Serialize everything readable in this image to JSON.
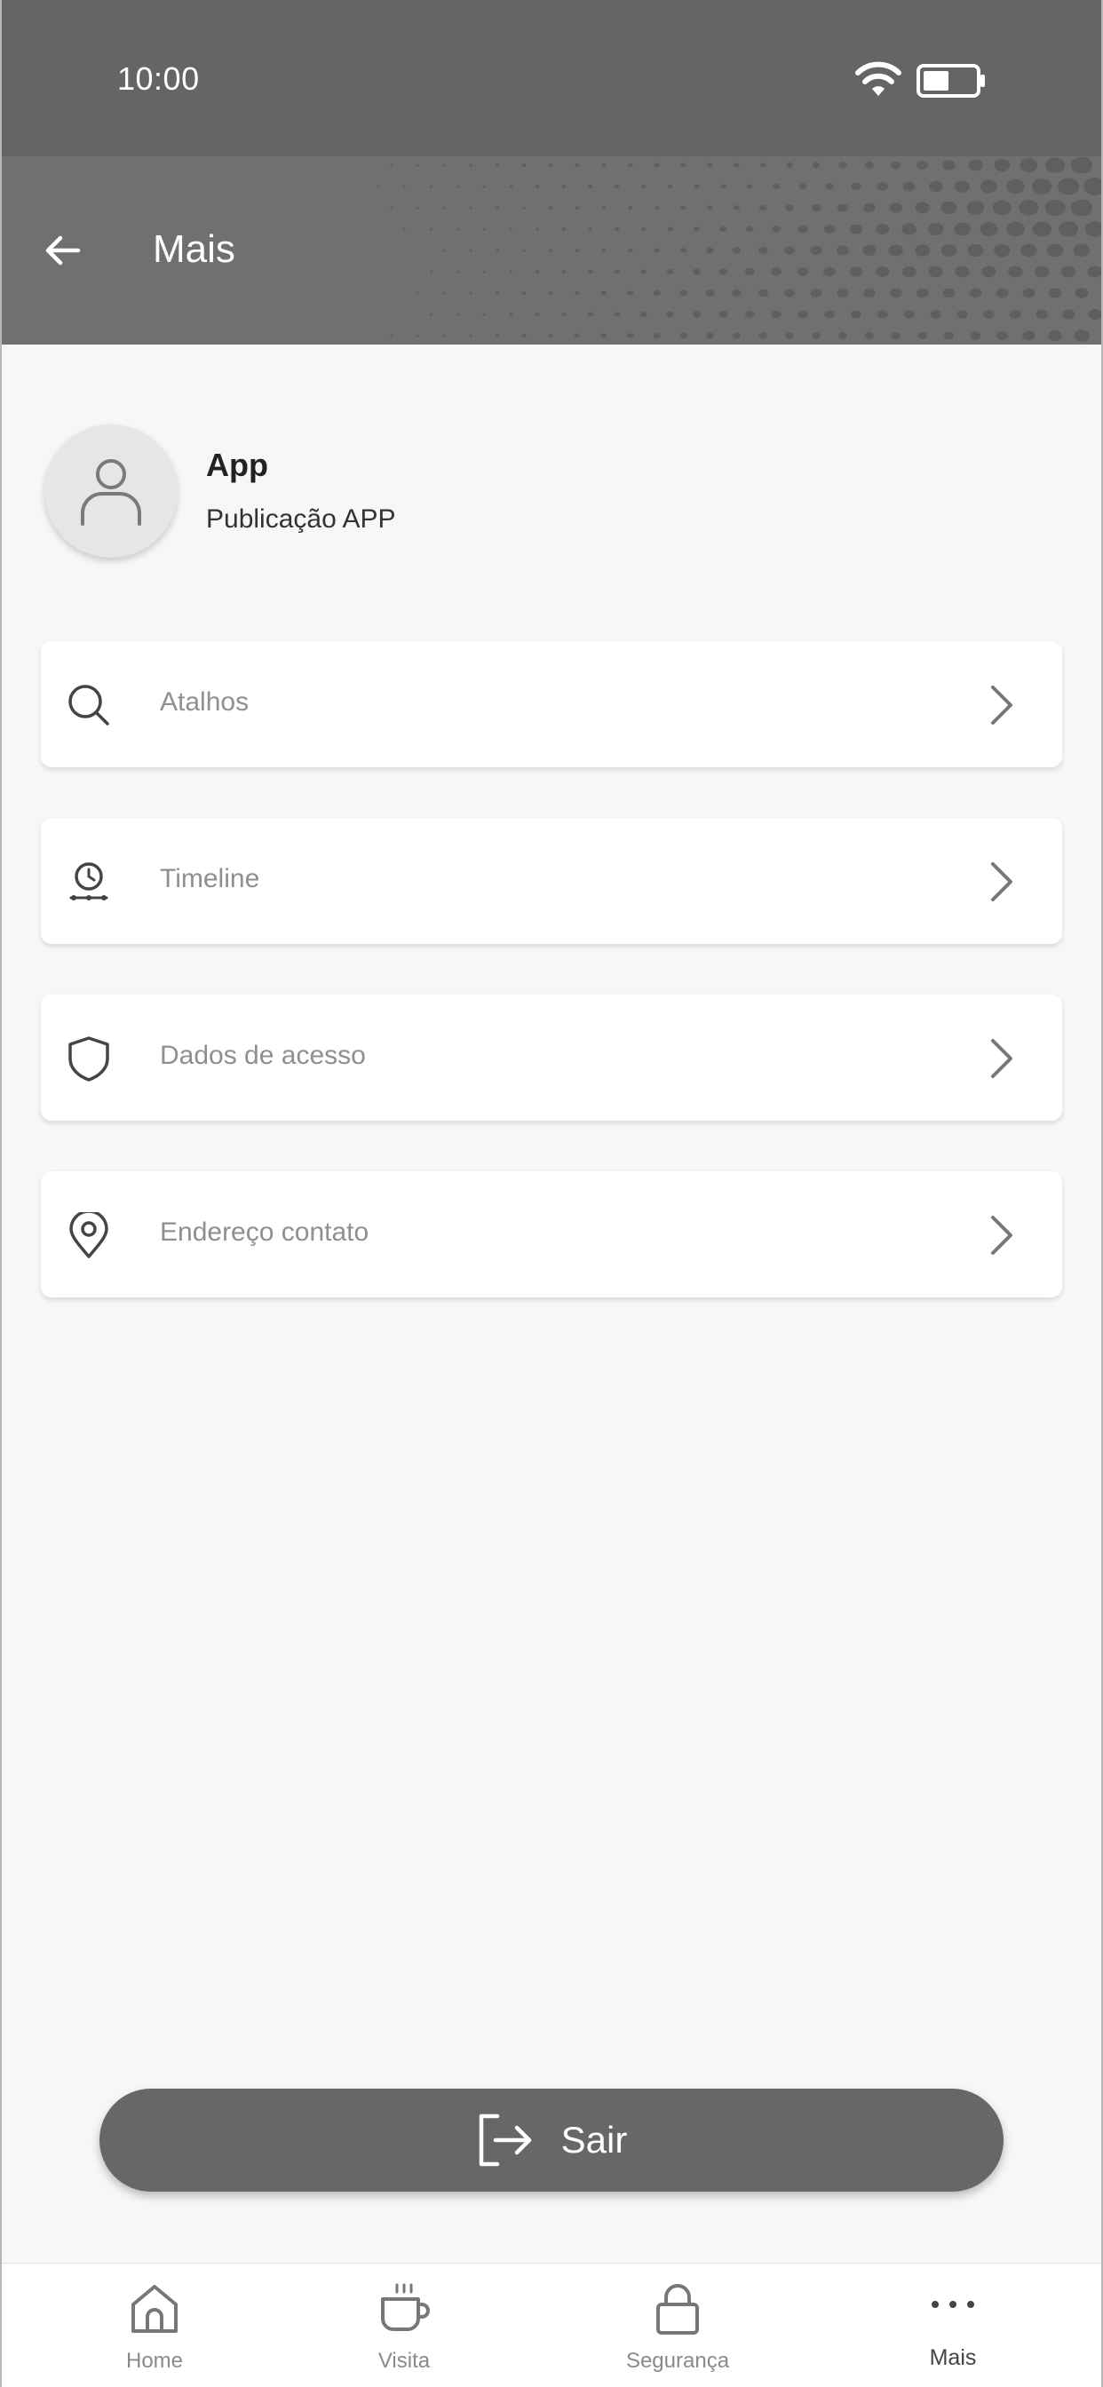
{
  "status_bar": {
    "time": "10:00",
    "wifi_icon": "wifi-icon",
    "battery_icon": "battery-icon"
  },
  "header": {
    "title": "Mais",
    "back_icon": "arrow-left-icon",
    "background_color": "#6f7071"
  },
  "profile": {
    "name": "App",
    "subtitle": "Publicação APP",
    "avatar_icon": "user-icon"
  },
  "menu": {
    "items": [
      {
        "label": "Atalhos",
        "icon": "search-icon"
      },
      {
        "label": "Timeline",
        "icon": "clock-timeline-icon"
      },
      {
        "label": "Dados de acesso",
        "icon": "shield-icon"
      },
      {
        "label": "Endereço contato",
        "icon": "location-pin-icon"
      }
    ]
  },
  "logout": {
    "label": "Sair",
    "icon": "logout-icon",
    "color": "#666767"
  },
  "bottom_nav": {
    "items": [
      {
        "label": "Home",
        "icon": "home-icon",
        "active": false
      },
      {
        "label": "Visita",
        "icon": "coffee-cup-icon",
        "active": false
      },
      {
        "label": "Segurança",
        "icon": "lock-icon",
        "active": false
      },
      {
        "label": "Mais",
        "icon": "more-dots-icon",
        "active": true
      }
    ]
  }
}
